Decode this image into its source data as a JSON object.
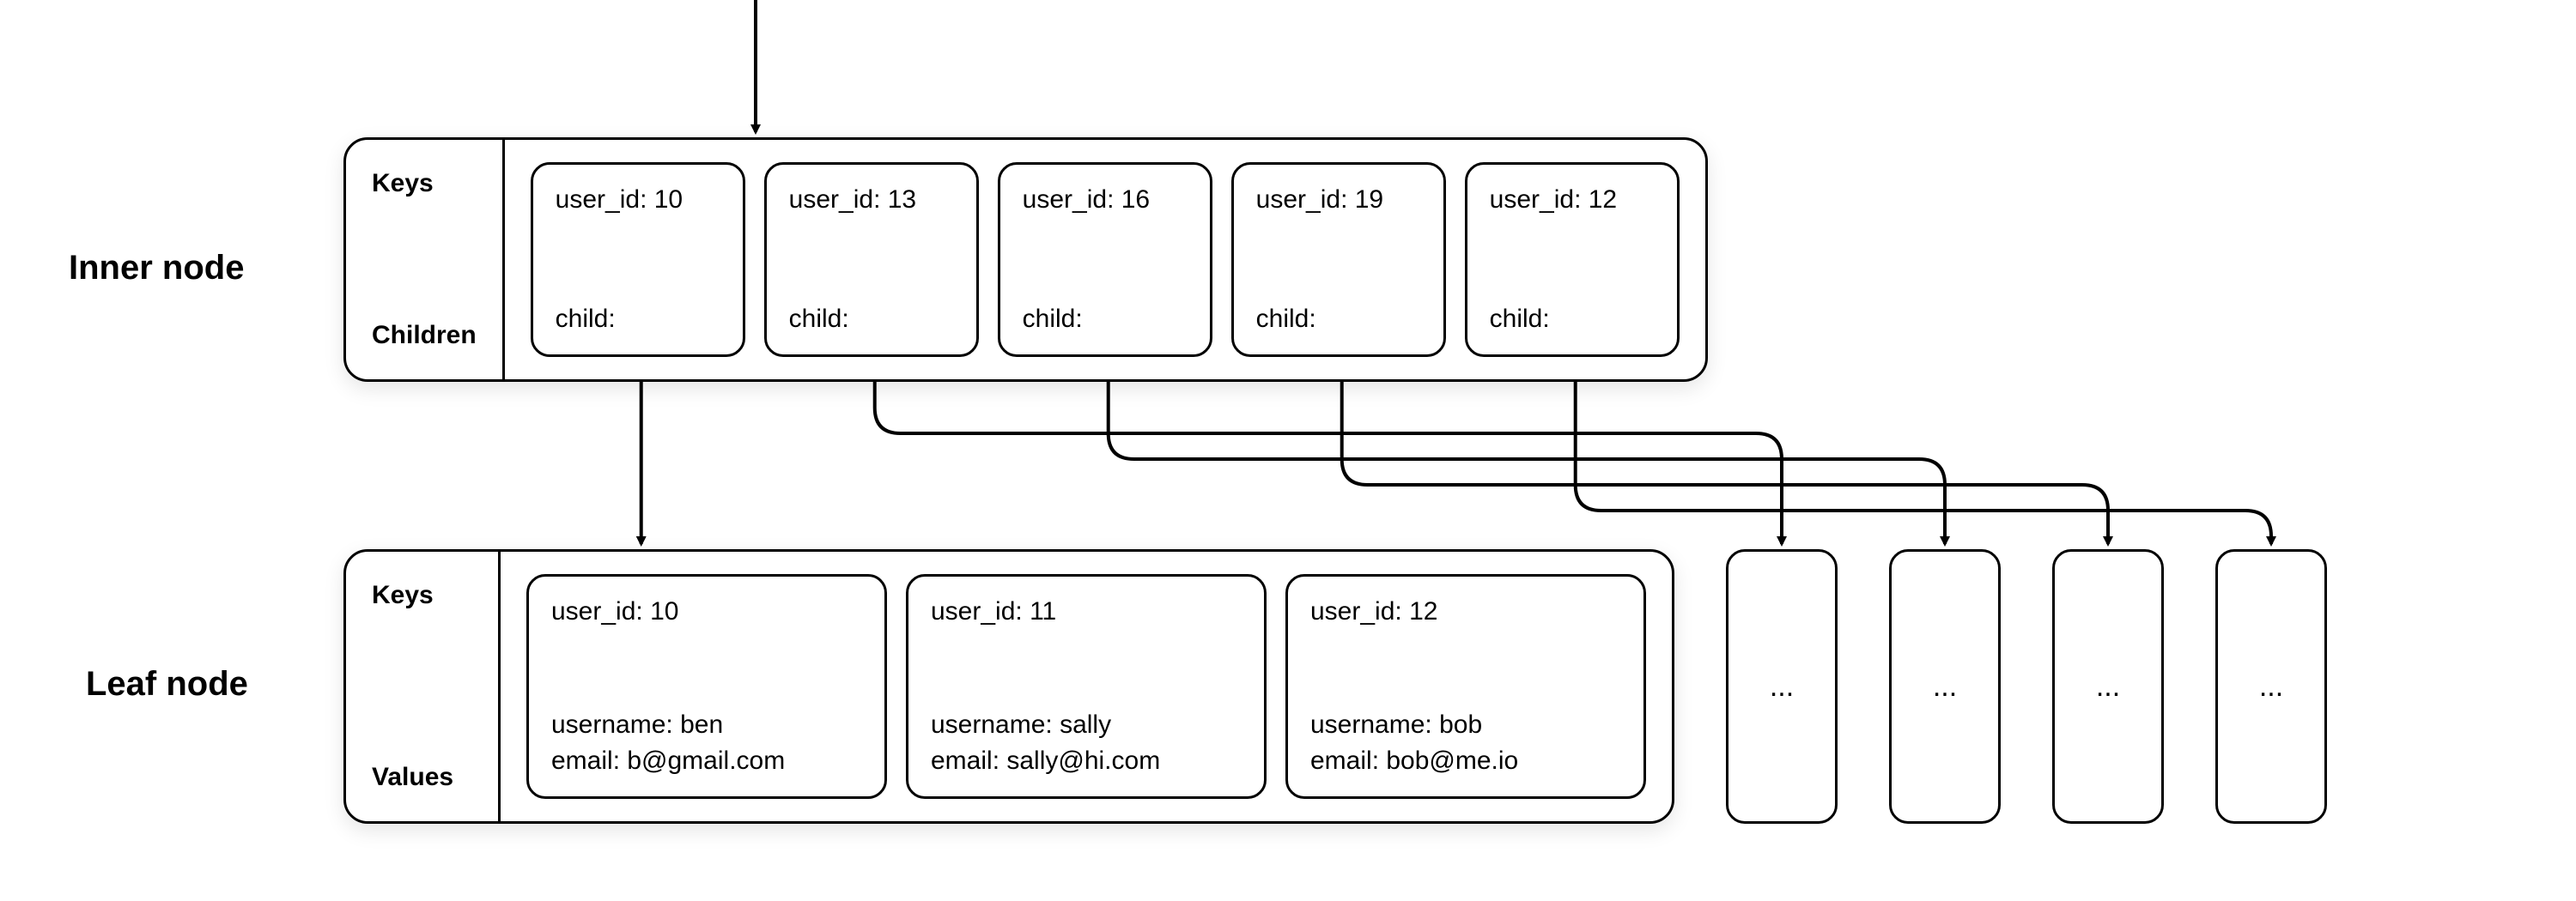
{
  "labels": {
    "inner_node": "Inner node",
    "leaf_node": "Leaf node"
  },
  "side": {
    "keys": "Keys",
    "children": "Children",
    "values": "Values"
  },
  "inner": {
    "slots": [
      {
        "key": "user_id: 10",
        "child_label": "child:"
      },
      {
        "key": "user_id: 13",
        "child_label": "child:"
      },
      {
        "key": "user_id: 16",
        "child_label": "child:"
      },
      {
        "key": "user_id: 19",
        "child_label": "child:"
      },
      {
        "key": "user_id: 12",
        "child_label": "child:"
      }
    ]
  },
  "leaf": {
    "slots": [
      {
        "key": "user_id: 10",
        "username": "username: ben",
        "email": "email: b@gmail.com"
      },
      {
        "key": "user_id: 11",
        "username": "username: sally",
        "email": "email: sally@hi.com"
      },
      {
        "key": "user_id: 12",
        "username": "username: bob",
        "email": "email: bob@me.io"
      }
    ]
  },
  "placeholders": {
    "text": "..."
  }
}
